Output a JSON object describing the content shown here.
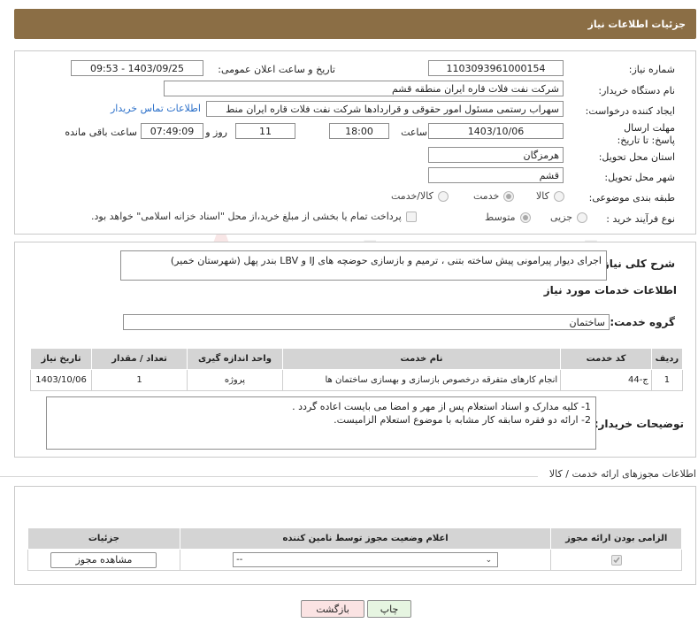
{
  "header": {
    "title": "جزئیات اطلاعات نیاز"
  },
  "form": {
    "need_number_label": "شماره نیاز:",
    "need_number": "1103093961000154",
    "announce_label": "تاریخ و ساعت اعلان عمومی:",
    "announce_value": "1403/09/25 - 09:53",
    "buyer_org_label": "نام دستگاه خریدار:",
    "buyer_org": "شرکت نفت فلات قاره ایران منطقه قشم",
    "requester_label": "ایجاد کننده درخواست:",
    "requester": "سهراب رستمی مسئول امور حقوقی و قراردادها شرکت نفت فلات قاره ایران منط",
    "contact_link": "اطلاعات تماس خریدار",
    "deadline_label": "مهلت ارسال پاسخ: تا تاریخ:",
    "deadline_date": "1403/10/06",
    "time_label": "ساعت",
    "deadline_time": "18:00",
    "days_value": "11",
    "days_label": "روز و",
    "remaining_time": "07:49:09",
    "remaining_label": "ساعت باقی مانده",
    "province_label": "استان محل تحویل:",
    "province": "هرمزگان",
    "city_label": "شهر محل تحویل:",
    "city": "قشم",
    "category_label": "طبقه بندی موضوعی:",
    "category_options": [
      "کالا",
      "خدمت",
      "کالا/خدمت"
    ],
    "category_selected": "خدمت",
    "process_label": "نوع فرآیند خرید :",
    "process_options": [
      "جزیی",
      "متوسط"
    ],
    "process_selected": "متوسط",
    "payment_note": "پرداخت تمام یا بخشی از مبلغ خرید،از محل \"اسناد خزانه اسلامی\" خواهد بود."
  },
  "description": {
    "label": "شرح کلی نیاز:",
    "text": "اجرای دیوار پیرامونی پیش ساخته بتنی ، ترمیم و بازسازی حوضچه های IJ و LBV بندر پهل (شهرستان خمیر)"
  },
  "services": {
    "section_title": "اطلاعات خدمات مورد نیاز",
    "group_label": "گروه خدمت:",
    "group_value": "ساختمان",
    "columns": [
      "ردیف",
      "کد خدمت",
      "نام خدمت",
      "واحد اندازه گیری",
      "تعداد / مقدار",
      "تاریخ نیاز"
    ],
    "rows": [
      {
        "index": "1",
        "code": "ج-44",
        "name": "انجام کارهای متفرقه درخصوص بازسازی و بهسازی ساختمان ها",
        "unit": "پروژه",
        "qty": "1",
        "date": "1403/10/06"
      }
    ]
  },
  "buyer_notes": {
    "label": "توضیحات خریدار:",
    "line1": "1- کلیه مدارک و اسناد استعلام پس از مهر و امضا می بایست اعاده گردد .",
    "line2": "2- ارائه دو فقره سابقه کار مشابه با موضوع استعلام الزامیست."
  },
  "permits": {
    "section_title": "اطلاعات مجوزهای ارائه خدمت / کالا",
    "columns": [
      "الزامی بودن ارائه مجوز",
      "اعلام وضعیت مجوز توسط نامین کننده",
      "جزئیات"
    ],
    "select_value": "--",
    "view_button": "مشاهده مجوز"
  },
  "actions": {
    "print": "چاپ",
    "back": "بازگشت"
  },
  "watermark": {
    "text": "AriaTender.neT"
  },
  "colors": {
    "header": "#8b6e45",
    "link": "#2a6fc9",
    "back_button": "#fbe3e3",
    "print_button": "#e6f5e1"
  }
}
